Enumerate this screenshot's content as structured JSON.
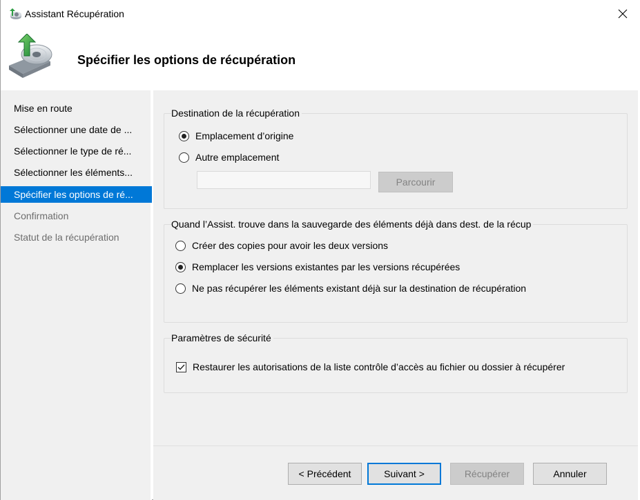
{
  "window": {
    "title": "Assistant Récupération",
    "app_icon": "backup-restore-icon",
    "close_icon": "close-icon"
  },
  "header": {
    "title": "Spécifier les options de récupération",
    "icon": "drive-restore-icon"
  },
  "sidebar": {
    "items": [
      {
        "label": "Mise en route",
        "state": "normal"
      },
      {
        "label": "Sélectionner une date de ...",
        "state": "normal"
      },
      {
        "label": "Sélectionner le type de ré...",
        "state": "normal"
      },
      {
        "label": "Sélectionner les éléments...",
        "state": "normal"
      },
      {
        "label": "Spécifier les options de ré...",
        "state": "active"
      },
      {
        "label": "Confirmation",
        "state": "disabled"
      },
      {
        "label": "Statut de la récupération",
        "state": "disabled"
      }
    ]
  },
  "destination": {
    "title": "Destination de la récupération",
    "options": [
      {
        "label": "Emplacement d’origine",
        "checked": true
      },
      {
        "label": "Autre emplacement",
        "checked": false
      }
    ],
    "path_value": "",
    "browse_label": "Parcourir"
  },
  "conflict": {
    "title": "Quand l’Assist. trouve dans la sauvegarde des éléments déjà dans dest. de la récup",
    "options": [
      {
        "label": "Créer des copies pour avoir les deux versions",
        "checked": false
      },
      {
        "label": "Remplacer les versions existantes par les versions récupérées",
        "checked": true
      },
      {
        "label": "Ne pas récupérer les éléments existant déjà sur la destination de récupération",
        "checked": false
      }
    ]
  },
  "security": {
    "title": "Paramètres de sécurité",
    "restore_acl_label": "Restaurer les autorisations de la liste contrôle d’accès au fichier ou dossier à récupérer",
    "restore_acl_checked": true
  },
  "footer": {
    "previous_label": "< Précédent",
    "next_label": "Suivant >",
    "recover_label": "Récupérer",
    "cancel_label": "Annuler"
  },
  "colors": {
    "accent": "#0078d7",
    "panel_bg": "#f0f0f0",
    "disabled_text": "#6d6d6d"
  }
}
